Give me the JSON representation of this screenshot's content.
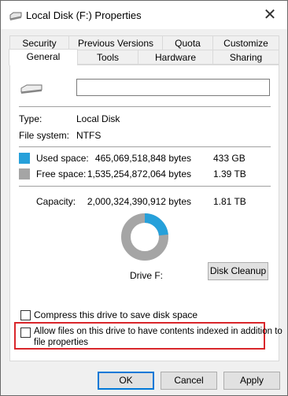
{
  "window": {
    "title": "Local Disk (F:) Properties"
  },
  "tabs_row1": [
    "Security",
    "Previous Versions",
    "Quota",
    "Customize"
  ],
  "tabs_row2": [
    "General",
    "Tools",
    "Hardware",
    "Sharing"
  ],
  "general": {
    "name_value": "",
    "type_label": "Type:",
    "type_value": "Local Disk",
    "fs_label": "File system:",
    "fs_value": "NTFS",
    "used_label": "Used space:",
    "used_bytes": "465,069,518,848 bytes",
    "used_size": "433 GB",
    "free_label": "Free space:",
    "free_bytes": "1,535,254,872,064 bytes",
    "free_size": "1.39 TB",
    "capacity_label": "Capacity:",
    "capacity_bytes": "2,000,324,390,912 bytes",
    "capacity_size": "1.81 TB",
    "drive_label": "Drive F:",
    "disk_cleanup_label": "Disk Cleanup",
    "compress_label": "Compress this drive to save disk space",
    "index_label_line1": "Allow files on this drive to have contents indexed in addition to",
    "index_label_line2": "file properties",
    "used_fraction": 0.2325
  },
  "colors": {
    "used": "#26a0da",
    "free": "#a5a5a5",
    "highlight": "#d9262b"
  },
  "buttons": {
    "ok": "OK",
    "cancel": "Cancel",
    "apply": "Apply"
  },
  "icons": {
    "title": "drive-icon",
    "close": "close-icon",
    "drive": "drive-icon"
  }
}
